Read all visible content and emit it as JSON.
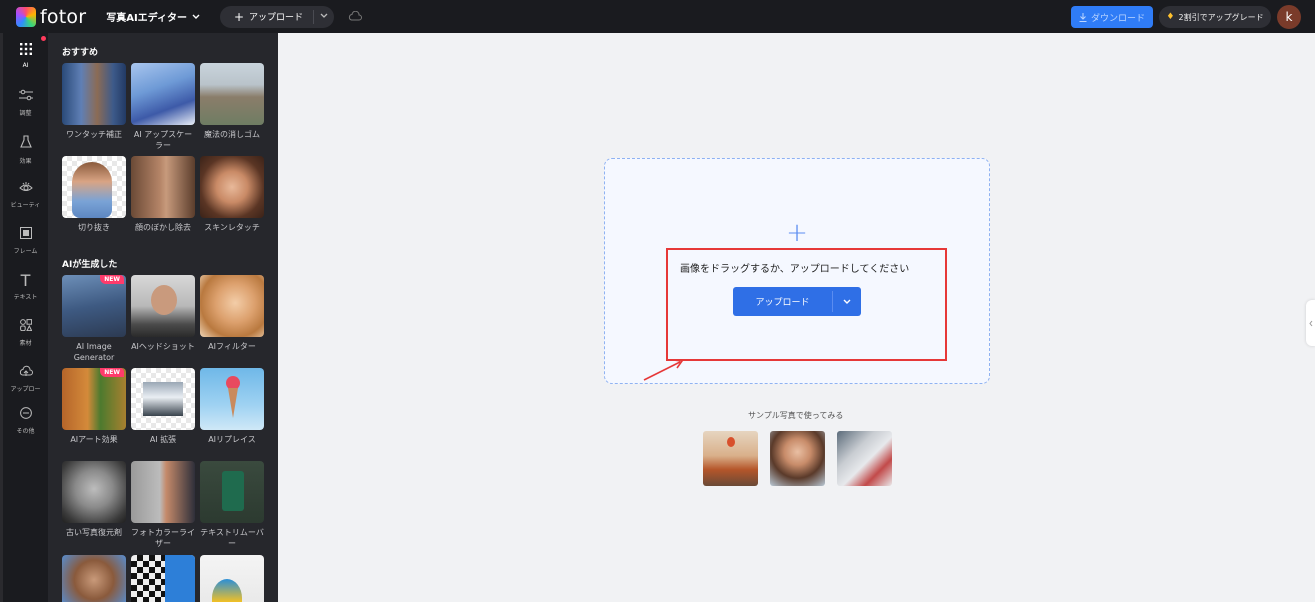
{
  "app": {
    "logo_text": "fotor",
    "mode_label": "写真AIエディター"
  },
  "header": {
    "upload_label": "アップロード",
    "download_label": "ダウンロード",
    "upgrade_label": "2割引でアップグレード",
    "avatar_initial": "k"
  },
  "rail": {
    "items": [
      {
        "label": "AI",
        "icon": "ai-grid-icon"
      },
      {
        "label": "調整",
        "icon": "sliders-icon"
      },
      {
        "label": "効果",
        "icon": "flask-icon"
      },
      {
        "label": "ビューティ",
        "icon": "eye-icon"
      },
      {
        "label": "フレーム",
        "icon": "frame-icon"
      },
      {
        "label": "テキスト",
        "icon": "text-icon"
      },
      {
        "label": "素材",
        "icon": "elements-icon"
      },
      {
        "label": "アップロー",
        "icon": "upload-cloud-icon"
      },
      {
        "label": "その他",
        "icon": "more-icon"
      }
    ]
  },
  "panel": {
    "section1_title": "おすすめ",
    "section2_title": "AIが生成した",
    "new_badge": "NEW",
    "tiles": [
      {
        "caption": "ワンタッチ補正"
      },
      {
        "caption": "AI アップスケーラー"
      },
      {
        "caption": "魔法の消しゴム"
      },
      {
        "caption": "切り抜き"
      },
      {
        "caption": "顔のぼかし除去"
      },
      {
        "caption": "スキンレタッチ"
      },
      {
        "caption": "AI Image Generator"
      },
      {
        "caption": "AIヘッドショット"
      },
      {
        "caption": "AIフィルター"
      },
      {
        "caption": "AIアート効果"
      },
      {
        "caption": "AI 拡張"
      },
      {
        "caption": "AIリプレイス"
      },
      {
        "caption": "古い写真復元剤"
      },
      {
        "caption": "フォトカラーライザー"
      },
      {
        "caption": "テキストリムーバー"
      }
    ]
  },
  "canvas": {
    "drop_text": "画像をドラッグするか、アップロードしてください",
    "upload_button": "アップロード",
    "sample_text": "サンプル写真で使ってみる"
  },
  "colors": {
    "accent": "#2f6fe6",
    "annotation": "#e63838",
    "topbar": "#1a1b1f",
    "panel": "#26272c"
  }
}
